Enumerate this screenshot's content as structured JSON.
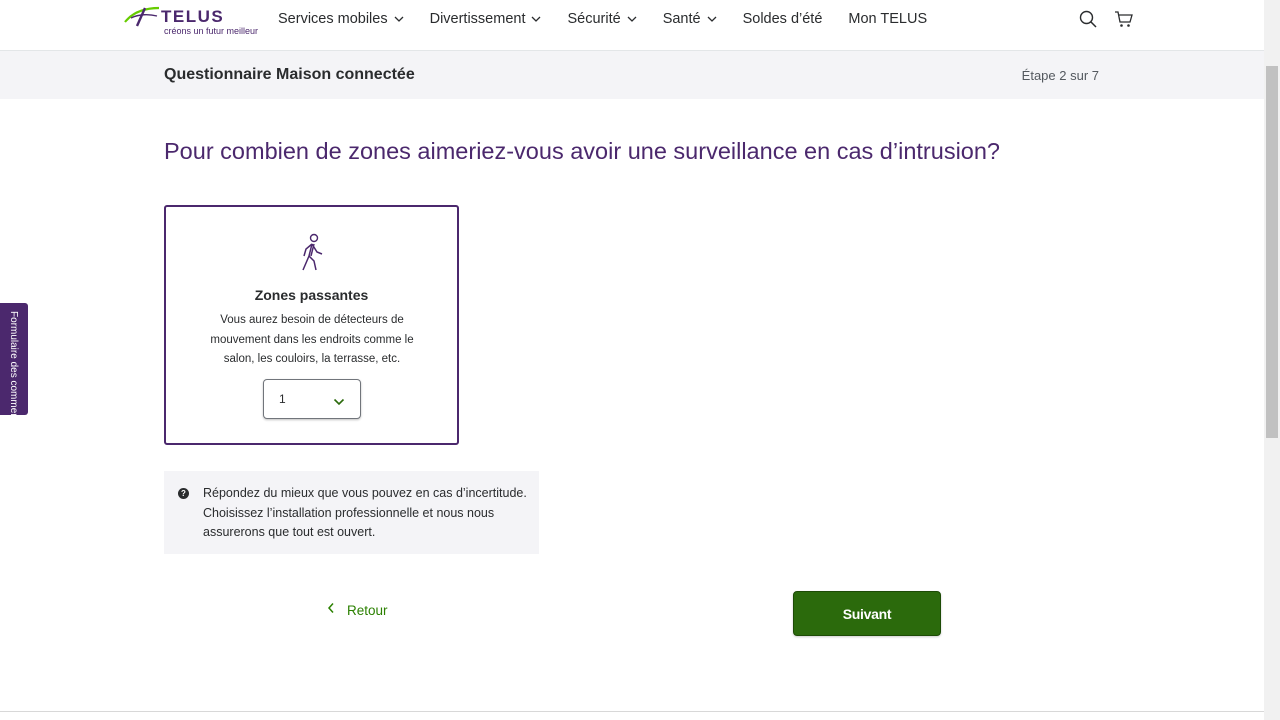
{
  "brand": {
    "name": "TELUS",
    "tagline": "créons un futur meilleur",
    "color": "#4b286d",
    "accent": "#66cc00"
  },
  "nav": {
    "items": [
      {
        "label": "Services mobiles",
        "dropdown": true
      },
      {
        "label": "Divertissement",
        "dropdown": true
      },
      {
        "label": "Sécurité",
        "dropdown": true
      },
      {
        "label": "Santé",
        "dropdown": true
      },
      {
        "label": "Soldes d’été",
        "dropdown": false
      },
      {
        "label": "Mon TELUS",
        "dropdown": false
      }
    ],
    "icons": [
      "search-icon",
      "cart-icon"
    ]
  },
  "stepbar": {
    "title": "Questionnaire Maison connectée",
    "step": "Étape 2 sur 7"
  },
  "question": "Pour combien de zones aimeriez-vous avoir une surveillance en cas d’intrusion?",
  "card": {
    "icon": "walking-person-icon",
    "title": "Zones passantes",
    "description": "Vous aurez besoin de détecteurs de mouvement dans les endroits comme le salon, les couloirs, la terrasse, etc.",
    "select_value": "1"
  },
  "info": {
    "icon": "question-circle-icon",
    "text": "Répondez du mieux que vous pouvez en cas d’incertitude. Choisissez l’installation professionnelle et nous nous assurerons que tout est ouvert."
  },
  "actions": {
    "back_label": "Retour",
    "next_label": "Suivant",
    "next_color": "#2b6a0c",
    "link_color": "#2b8000"
  },
  "feedback_tab": {
    "label": "Formulaire des comment"
  }
}
